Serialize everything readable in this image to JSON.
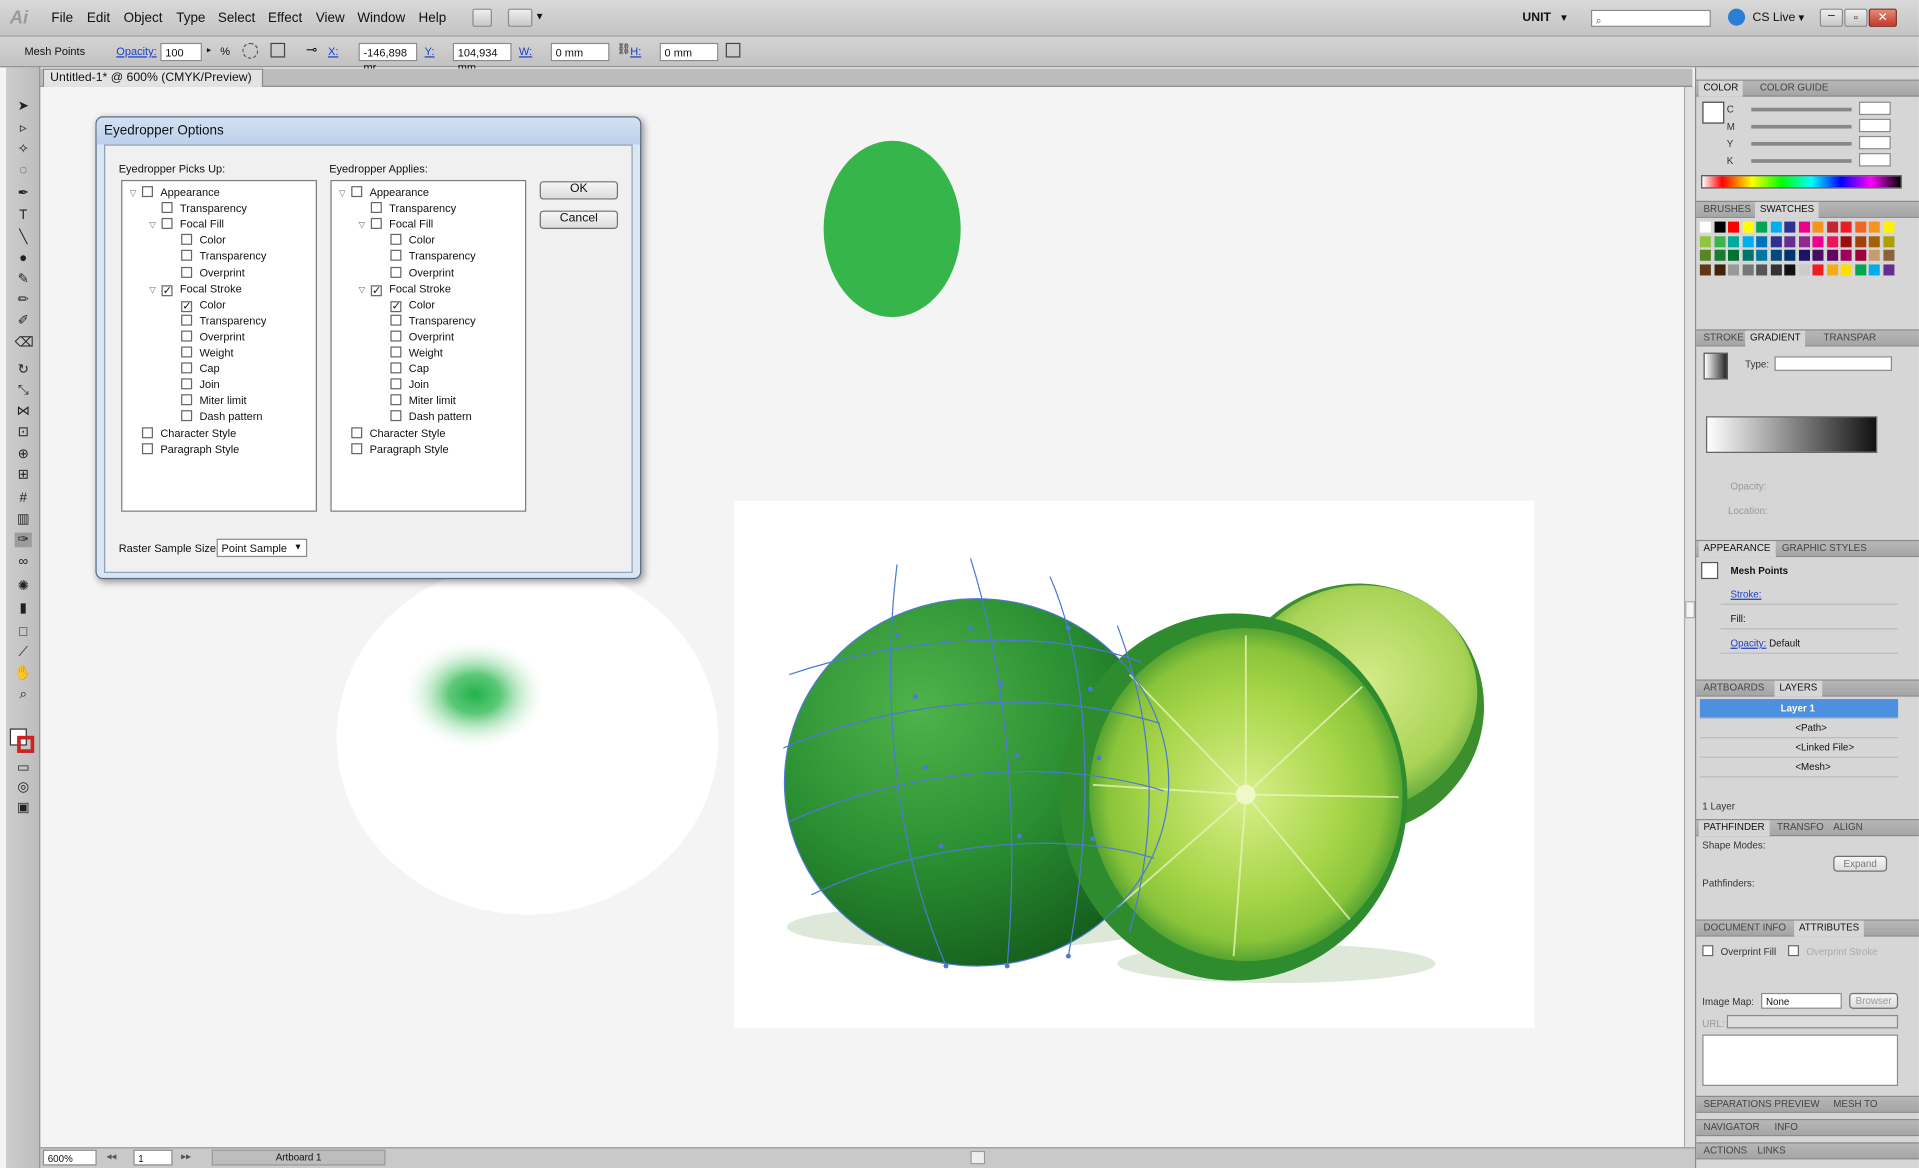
{
  "menubar": {
    "logo": "Ai",
    "items": [
      "File",
      "Edit",
      "Object",
      "Type",
      "Select",
      "Effect",
      "View",
      "Window",
      "Help"
    ],
    "workspace": "UNIT",
    "cslive": "CS Live"
  },
  "control": {
    "mode_label": "Mesh Points",
    "opacity_label": "Opacity:",
    "opacity_value": "100",
    "pct": "%",
    "x_label": "X:",
    "x_value": "-146,898 mr",
    "y_label": "Y:",
    "y_value": "104,934 mm",
    "w_label": "W:",
    "w_value": "0 mm",
    "h_label": "H:",
    "h_value": "0 mm"
  },
  "doc_tab": {
    "title": "Untitled-1* @ 600% (CMYK/Preview)"
  },
  "dialog": {
    "title": "Eyedropper Options",
    "picks_label": "Eyedropper Picks Up:",
    "applies_label": "Eyedropper Applies:",
    "ok": "OK",
    "cancel": "Cancel",
    "raster_label": "Raster Sample Size:",
    "raster_value": "Point Sample",
    "items": [
      {
        "label": "Appearance",
        "indent": 0,
        "tri": true,
        "checked": false
      },
      {
        "label": "Transparency",
        "indent": 1,
        "tri": false,
        "checked": false
      },
      {
        "label": "Focal Fill",
        "indent": 1,
        "tri": true,
        "checked": false
      },
      {
        "label": "Color",
        "indent": 2,
        "tri": false,
        "checked": false
      },
      {
        "label": "Transparency",
        "indent": 2,
        "tri": false,
        "checked": false
      },
      {
        "label": "Overprint",
        "indent": 2,
        "tri": false,
        "checked": false
      },
      {
        "label": "Focal Stroke",
        "indent": 1,
        "tri": true,
        "checked": true
      },
      {
        "label": "Color",
        "indent": 2,
        "tri": false,
        "checked": true
      },
      {
        "label": "Transparency",
        "indent": 2,
        "tri": false,
        "checked": false
      },
      {
        "label": "Overprint",
        "indent": 2,
        "tri": false,
        "checked": false
      },
      {
        "label": "Weight",
        "indent": 2,
        "tri": false,
        "checked": false
      },
      {
        "label": "Cap",
        "indent": 2,
        "tri": false,
        "checked": false
      },
      {
        "label": "Join",
        "indent": 2,
        "tri": false,
        "checked": false
      },
      {
        "label": "Miter limit",
        "indent": 2,
        "tri": false,
        "checked": false
      },
      {
        "label": "Dash pattern",
        "indent": 2,
        "tri": false,
        "checked": false
      },
      {
        "label": "Character Style",
        "indent": 0,
        "tri": false,
        "checked": false
      },
      {
        "label": "Paragraph Style",
        "indent": 0,
        "tri": false,
        "checked": false
      }
    ]
  },
  "status": {
    "zoom": "600%",
    "page": "1",
    "artboard": "Artboard 1"
  },
  "panels": {
    "color_tab": "COLOR",
    "color_guide_tab": "COLOR GUIDE",
    "cmyk": [
      "C",
      "M",
      "Y",
      "K"
    ],
    "brushes_tab": "BRUSHES",
    "swatches_tab": "SWATCHES",
    "stroke_tab": "STROKE",
    "gradient_tab": "GRADIENT",
    "transparency_tab": "TRANSPAR",
    "type_label": "Type:",
    "opacity_label": "Opacity:",
    "location_label": "Location:",
    "appearance_tab": "APPEARANCE",
    "graphic_styles_tab": "GRAPHIC STYLES",
    "app_title": "Mesh Points",
    "stroke_label": "Stroke:",
    "fill_label": "Fill:",
    "app_opacity_label": "Opacity:",
    "app_opacity_value": "Default",
    "artboards_tab": "ARTBOARDS",
    "layers_tab": "LAYERS",
    "layers": [
      "Layer 1",
      "<Path>",
      "<Linked File>",
      "<Mesh>"
    ],
    "layer_count": "1 Layer",
    "pathfinder_tab": "PATHFINDER",
    "transform_tab": "TRANSFO",
    "align_tab": "ALIGN",
    "shape_modes": "Shape Modes:",
    "expand": "Expand",
    "pathfinders": "Pathfinders:",
    "docinfo_tab": "DOCUMENT INFO",
    "attributes_tab": "ATTRIBUTES",
    "overprint_fill": "Overprint Fill",
    "overprint_stroke": "Overprint Stroke",
    "image_map_label": "Image Map:",
    "image_map_value": "None",
    "browser": "Browser",
    "url_label": "URL:",
    "sep_preview_tab": "SEPARATIONS PREVIEW",
    "mesh_tab": "MESH TO",
    "navigator_tab": "NAVIGATOR",
    "info_tab": "INFO",
    "actions_tab": "ACTIONS",
    "links_tab": "LINKS"
  },
  "colors": {
    "green_ellipse": "#35b54a",
    "gradient_blob": "#22b14c",
    "mesh_line": "#4d79d6",
    "lime_dark": "#1e7d2a",
    "lime_light": "#a8d64a"
  }
}
